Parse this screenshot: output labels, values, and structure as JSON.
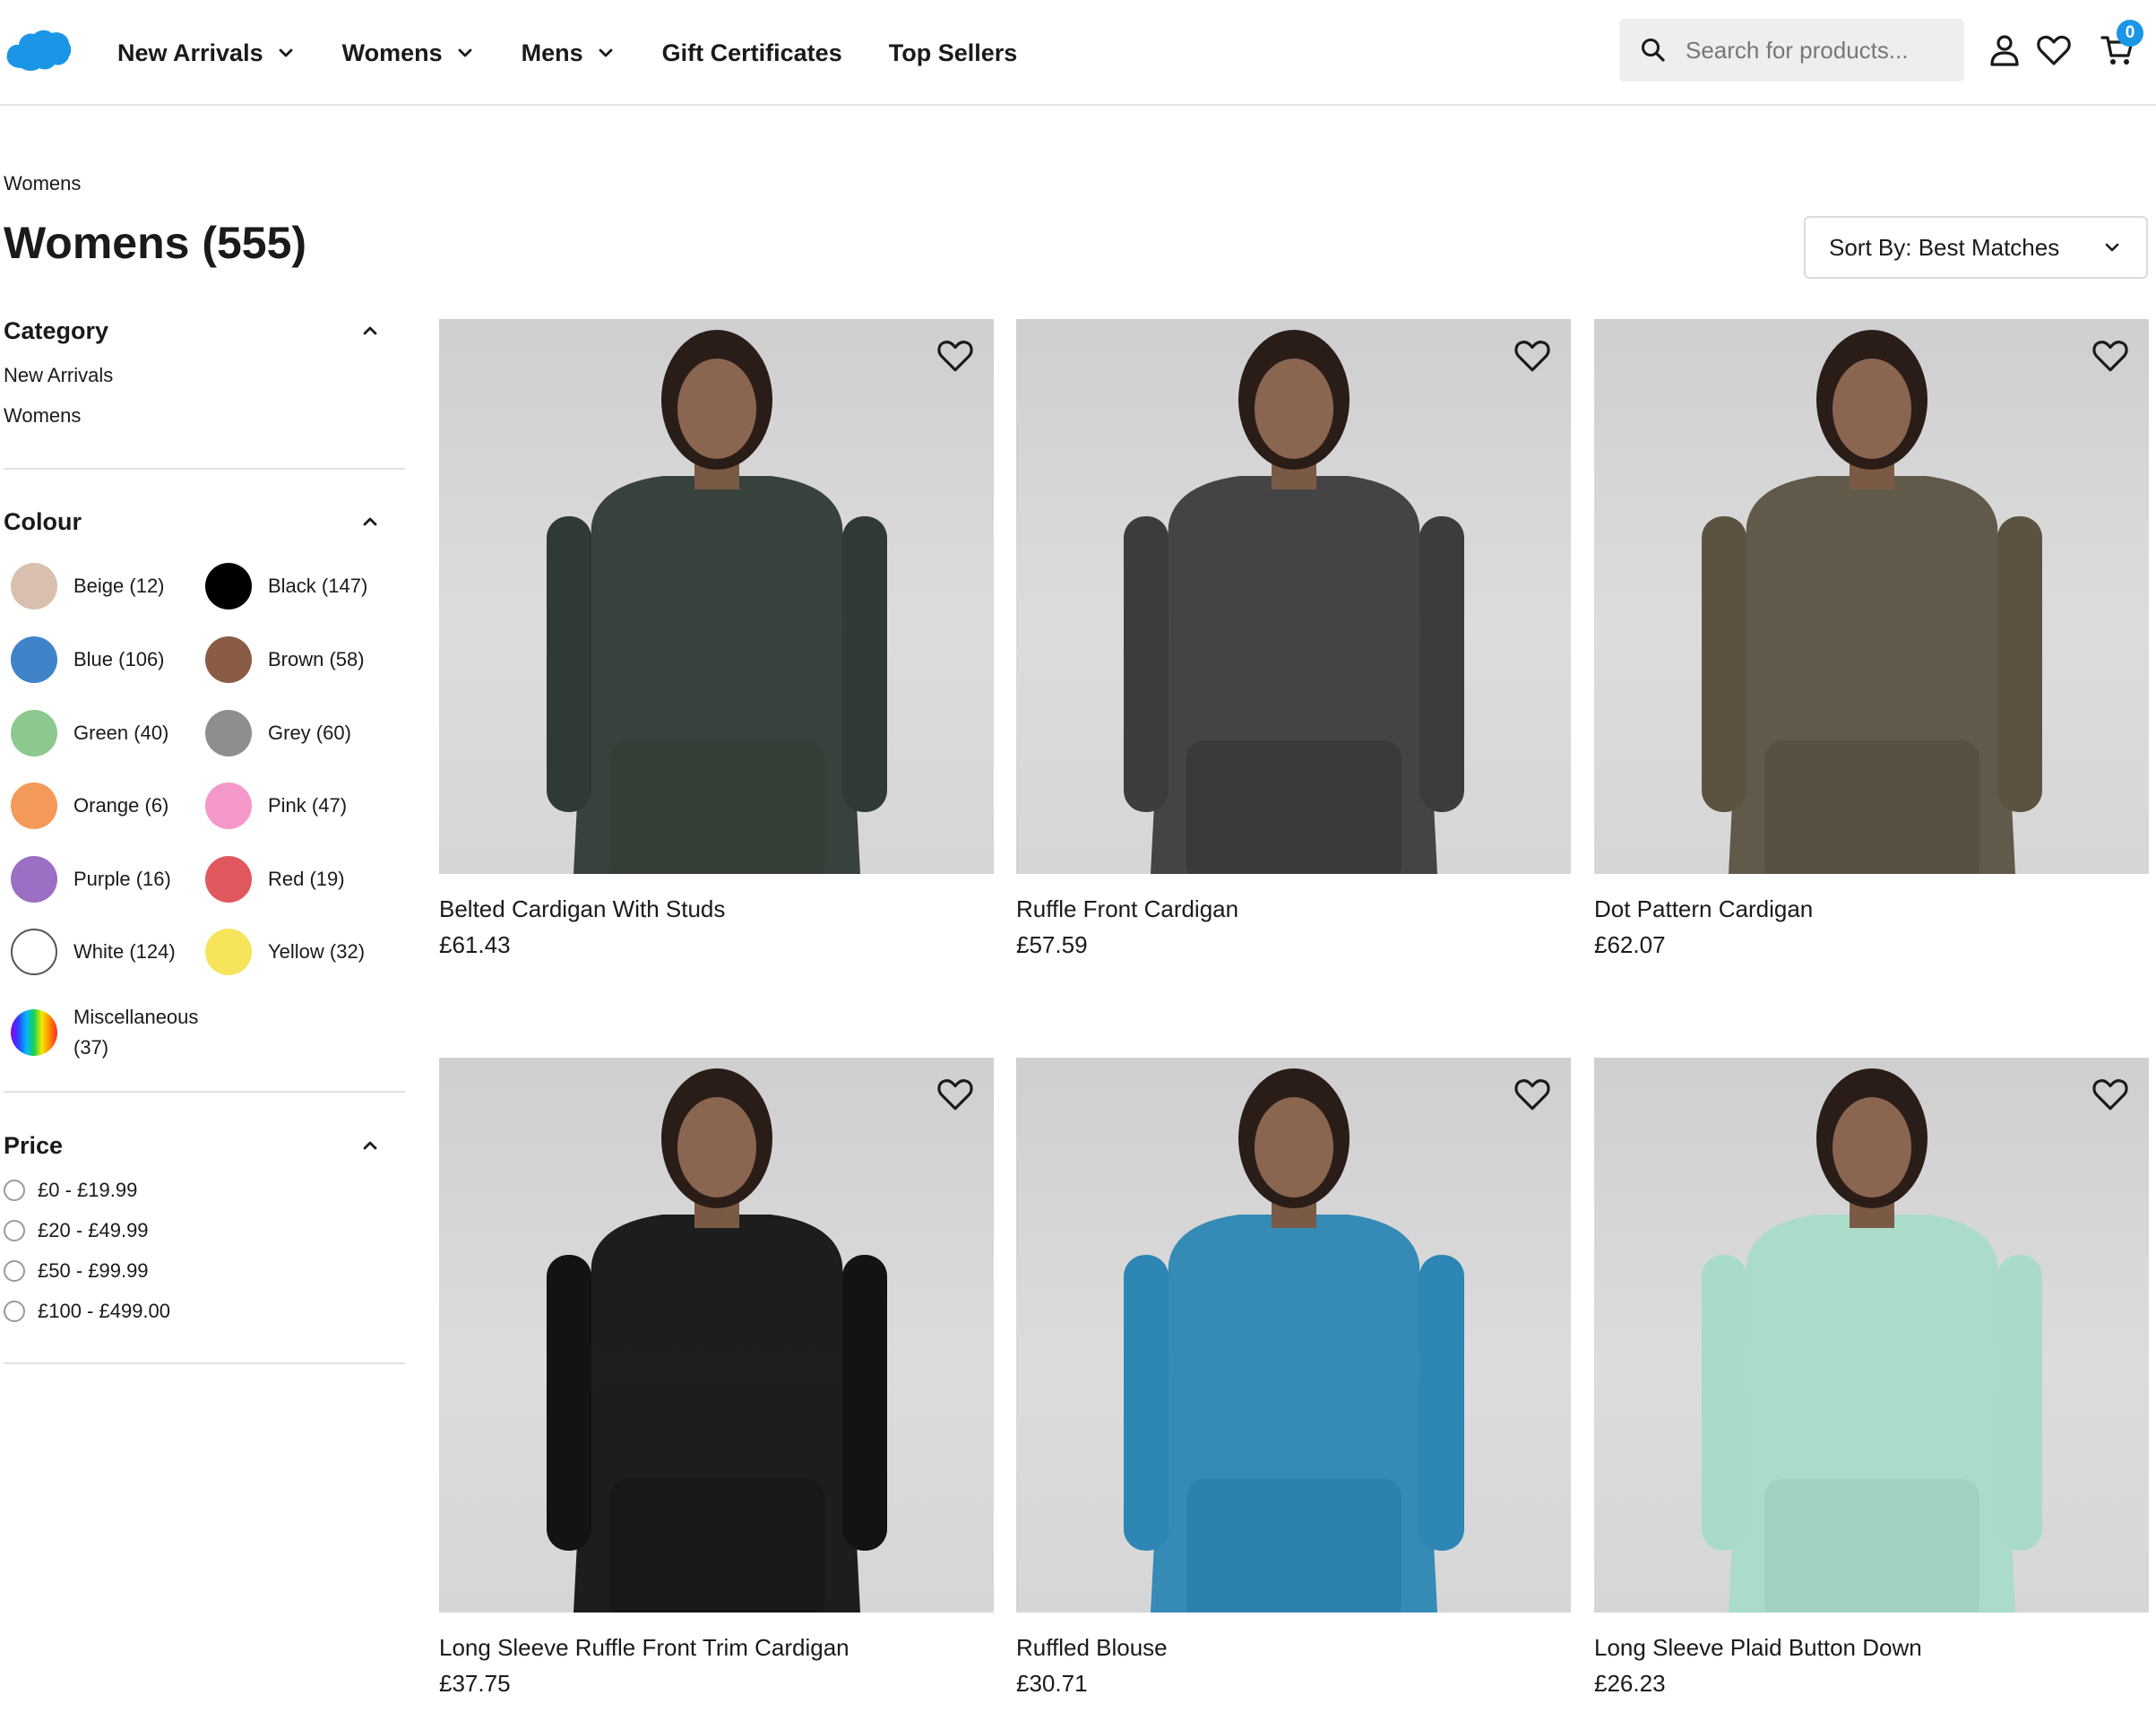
{
  "header": {
    "nav": [
      {
        "label": "New Arrivals",
        "has_dropdown": true
      },
      {
        "label": "Womens",
        "has_dropdown": true
      },
      {
        "label": "Mens",
        "has_dropdown": true
      },
      {
        "label": "Gift Certificates",
        "has_dropdown": false
      },
      {
        "label": "Top Sellers",
        "has_dropdown": false
      }
    ],
    "search_placeholder": "Search for products...",
    "cart_count": "0",
    "icons": [
      "salesforce-cloud-logo",
      "search-icon",
      "account-icon",
      "wishlist-heart-icon",
      "cart-icon"
    ],
    "accent_color": "#1b96e6"
  },
  "breadcrumb": "Womens",
  "page_title": "Womens (555)",
  "sort": {
    "label": "Sort By: Best Matches"
  },
  "filters": {
    "category": {
      "title": "Category",
      "items": [
        "New Arrivals",
        "Womens"
      ]
    },
    "colour": {
      "title": "Colour",
      "items": [
        {
          "label": "Beige (12)",
          "color": "#d9bfae"
        },
        {
          "label": "Black (147)",
          "color": "#000000"
        },
        {
          "label": "Blue (106)",
          "color": "#3f84c8"
        },
        {
          "label": "Brown (58)",
          "color": "#8a5c45"
        },
        {
          "label": "Green (40)",
          "color": "#8cc98f"
        },
        {
          "label": "Grey (60)",
          "color": "#8e8e8e"
        },
        {
          "label": "Orange (6)",
          "color": "#f39a5a"
        },
        {
          "label": "Pink (47)",
          "color": "#f497c9"
        },
        {
          "label": "Purple (16)",
          "color": "#9b6fc4"
        },
        {
          "label": "Red (19)",
          "color": "#e0585d"
        },
        {
          "label": "White (124)",
          "color": "#ffffff"
        },
        {
          "label": "Yellow (32)",
          "color": "#f6e55a"
        },
        {
          "label": "Miscellaneous (37)",
          "color": "multicolor"
        }
      ]
    },
    "price": {
      "title": "Price",
      "options": [
        "£0 - £19.99",
        "£20 - £49.99",
        "£50 - £99.99",
        "£100 - £499.00"
      ]
    }
  },
  "products": [
    {
      "name": "Belted Cardigan With Studs",
      "price": "£61.43",
      "top_color": "#2f3a34",
      "bottom_color": "#8b8775"
    },
    {
      "name": "Ruffle Front Cardigan",
      "price": "£57.59",
      "top_color": "#3c3c3e",
      "bottom_color": "#151517"
    },
    {
      "name": "Dot Pattern Cardigan",
      "price": "£62.07",
      "top_color": "#5b5241",
      "bottom_color": "#2c302c"
    },
    {
      "name": "Long Sleeve Ruffle Front Trim Cardigan",
      "price": "£37.75",
      "top_color": "#131315",
      "bottom_color": "#6f6f70"
    },
    {
      "name": "Ruffled Blouse",
      "price": "£30.71",
      "top_color": "#2d86b4",
      "bottom_color": "#2a2a2c"
    },
    {
      "name": "Long Sleeve Plaid Button Down",
      "price": "£26.23",
      "top_color": "#a9dcc8",
      "bottom_color": "#1a1a1c"
    }
  ]
}
